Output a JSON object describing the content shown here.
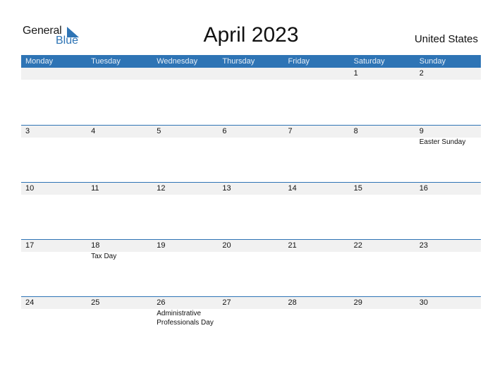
{
  "logo": {
    "word1": "General",
    "word2": "Blue",
    "accent": "#2e74b5"
  },
  "title": "April 2023",
  "country": "United States",
  "colors": {
    "header_bg": "#2e74b5",
    "row_strip": "#f1f1f1"
  },
  "weekdays": [
    "Monday",
    "Tuesday",
    "Wednesday",
    "Thursday",
    "Friday",
    "Saturday",
    "Sunday"
  ],
  "weeks": [
    [
      {
        "d": "",
        "e": ""
      },
      {
        "d": "",
        "e": ""
      },
      {
        "d": "",
        "e": ""
      },
      {
        "d": "",
        "e": ""
      },
      {
        "d": "",
        "e": ""
      },
      {
        "d": "1",
        "e": ""
      },
      {
        "d": "2",
        "e": ""
      }
    ],
    [
      {
        "d": "3",
        "e": ""
      },
      {
        "d": "4",
        "e": ""
      },
      {
        "d": "5",
        "e": ""
      },
      {
        "d": "6",
        "e": ""
      },
      {
        "d": "7",
        "e": ""
      },
      {
        "d": "8",
        "e": ""
      },
      {
        "d": "9",
        "e": "Easter Sunday"
      }
    ],
    [
      {
        "d": "10",
        "e": ""
      },
      {
        "d": "11",
        "e": ""
      },
      {
        "d": "12",
        "e": ""
      },
      {
        "d": "13",
        "e": ""
      },
      {
        "d": "14",
        "e": ""
      },
      {
        "d": "15",
        "e": ""
      },
      {
        "d": "16",
        "e": ""
      }
    ],
    [
      {
        "d": "17",
        "e": ""
      },
      {
        "d": "18",
        "e": "Tax Day"
      },
      {
        "d": "19",
        "e": ""
      },
      {
        "d": "20",
        "e": ""
      },
      {
        "d": "21",
        "e": ""
      },
      {
        "d": "22",
        "e": ""
      },
      {
        "d": "23",
        "e": ""
      }
    ],
    [
      {
        "d": "24",
        "e": ""
      },
      {
        "d": "25",
        "e": ""
      },
      {
        "d": "26",
        "e": "Administrative Professionals Day"
      },
      {
        "d": "27",
        "e": ""
      },
      {
        "d": "28",
        "e": ""
      },
      {
        "d": "29",
        "e": ""
      },
      {
        "d": "30",
        "e": ""
      }
    ]
  ]
}
